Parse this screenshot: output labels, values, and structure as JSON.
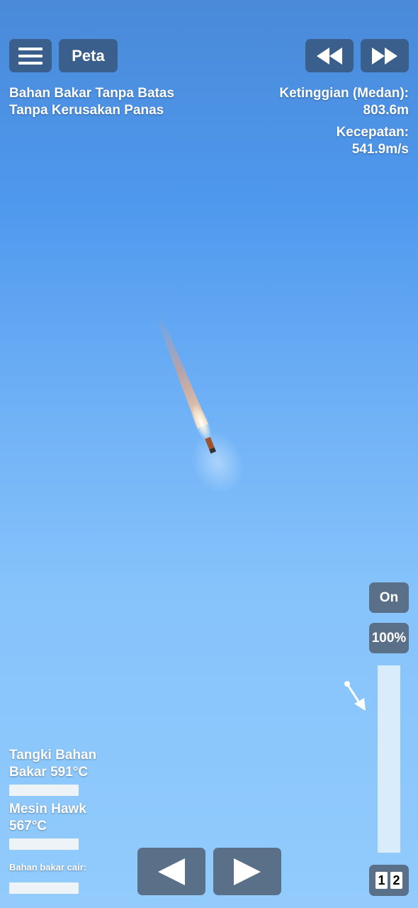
{
  "toolbar": {
    "menu_icon": "hamburger-menu-icon",
    "map_label": "Peta",
    "rewind_icon": "rewind-icon",
    "fast_forward_icon": "fast-forward-icon"
  },
  "cheats": {
    "line1": "Bahan Bakar Tanpa Batas",
    "line2": "Tanpa Kerusakan Panas"
  },
  "telemetry": {
    "altitude_label": "Ketinggian (Medan):",
    "altitude_value": "803.6m",
    "speed_label": "Kecepatan:",
    "speed_value": "541.9m/s"
  },
  "engine_controls": {
    "on_label": "On",
    "throttle_label": "100%",
    "throttle_level": 1.0
  },
  "parts": {
    "tank_line1": "Tangki Bahan",
    "tank_line2": "Bakar 591°C",
    "engine_line1": "Mesin Hawk",
    "engine_line2": "567°C",
    "fuel_label": "Bahan bakar cair:"
  },
  "nav": {
    "prev_icon": "left-arrow-icon",
    "next_icon": "right-arrow-icon"
  },
  "stages": {
    "stage1": "1",
    "stage2": "2"
  },
  "colors": {
    "button_dark": "#3a5f8c",
    "button_gray": "#5a7089",
    "sky_top": "#4a8ad8",
    "sky_bottom": "#92cbfc"
  }
}
